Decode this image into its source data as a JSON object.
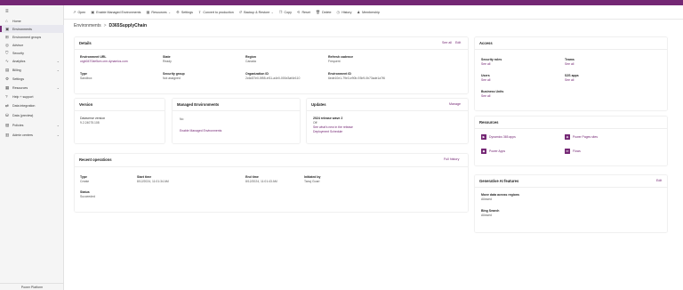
{
  "sidebar": {
    "items": [
      {
        "label": "Home",
        "icon": "home-icon",
        "glyph": "⌂"
      },
      {
        "label": "Environments",
        "icon": "environments-icon",
        "glyph": "▣"
      },
      {
        "label": "Environment groups",
        "icon": "environment-groups-icon",
        "glyph": "⊞"
      },
      {
        "label": "Advisor",
        "icon": "advisor-icon",
        "glyph": "◎"
      },
      {
        "label": "Security",
        "icon": "security-icon",
        "glyph": "⛉"
      },
      {
        "label": "Analytics",
        "icon": "analytics-icon",
        "glyph": "∿"
      },
      {
        "label": "Billing",
        "icon": "billing-icon",
        "glyph": "▤"
      },
      {
        "label": "Settings",
        "icon": "settings-icon",
        "glyph": "⚙"
      },
      {
        "label": "Resources",
        "icon": "resources-icon",
        "glyph": "▦"
      },
      {
        "label": "Help + support",
        "icon": "help-icon",
        "glyph": "?"
      },
      {
        "label": "Data integration",
        "icon": "data-integration-icon",
        "glyph": "⇄"
      },
      {
        "label": "Data (preview)",
        "icon": "data-icon",
        "glyph": "⛁"
      },
      {
        "label": "Policies",
        "icon": "policies-icon",
        "glyph": "▧"
      },
      {
        "label": "Admin centers",
        "icon": "admin-centers-icon",
        "glyph": "▥"
      }
    ],
    "footer": "Power Platform"
  },
  "toolbar": {
    "items": [
      {
        "label": "Open",
        "icon": "open-icon",
        "glyph": "↗"
      },
      {
        "label": "Enable Managed Environments",
        "icon": "managed-environments-icon",
        "glyph": "▣"
      },
      {
        "label": "Resources",
        "icon": "resources-icon",
        "glyph": "▦"
      },
      {
        "label": "Settings",
        "icon": "settings-icon",
        "glyph": "⚙"
      },
      {
        "label": "Convert to production",
        "icon": "convert-icon",
        "glyph": "⇧"
      },
      {
        "label": "Backup & Restore",
        "icon": "backup-icon",
        "glyph": "↺"
      },
      {
        "label": "Copy",
        "icon": "copy-icon",
        "glyph": "❐"
      },
      {
        "label": "Reset",
        "icon": "reset-icon",
        "glyph": "⟲"
      },
      {
        "label": "Delete",
        "icon": "delete-icon",
        "glyph": "🗑"
      },
      {
        "label": "History",
        "icon": "history-icon",
        "glyph": "◷"
      },
      {
        "label": "Membership",
        "icon": "membership-icon",
        "glyph": "♟"
      }
    ]
  },
  "breadcrumb": {
    "parent": "Environments",
    "separator": ">",
    "current": "D365SupplyChain"
  },
  "details": {
    "title": "Details",
    "see_all": "See all",
    "edit": "Edit",
    "fields": {
      "env_url_label": "Environment URL",
      "env_url_value": "orgb0470de5cm.crm.dynamics.com",
      "state_label": "State",
      "state_value": "Ready",
      "region_label": "Region",
      "region_value": "Canada",
      "refresh_label": "Refresh cadence",
      "refresh_value": "Frequent",
      "type_label": "Type",
      "type_value": "Sandbox",
      "security_group_label": "Security group",
      "security_group_value": "Not assigned",
      "org_id_label": "Organization ID",
      "org_id_value": "2c6d37e0-5f55-ef11-a4e0-000d3af4e110",
      "env_id_label": "Environment ID",
      "env_id_value": "6ede10e1-79e3-e90b-93b9-0b73ade1a7f6"
    }
  },
  "version": {
    "title": "Version",
    "label": "Dataverse version",
    "value": "9.2.24075.108"
  },
  "managed": {
    "title": "Managed Environments",
    "value": "No",
    "link": "Enable Managed Environments"
  },
  "updates": {
    "title": "Updates",
    "manage": "Manage",
    "wave": "2024 release wave 2",
    "status": "Off",
    "link1": "See what's new in the release",
    "link2": "Deployment Schedule"
  },
  "recent_ops": {
    "title": "Recent operations",
    "full_history": "Full history",
    "type_label": "Type",
    "type_value": "Create",
    "start_label": "Start time",
    "start_value": "8/12/2024, 11:01:34 AM",
    "end_label": "End time",
    "end_value": "8/12/2024, 11:01:43 AM",
    "initiated_label": "Initiated by",
    "initiated_value": "Tanuj Goari",
    "status_label": "Status",
    "status_value": "Succeeded"
  },
  "access": {
    "title": "Access",
    "security_roles_label": "Security roles",
    "security_roles_link": "See all",
    "teams_label": "Teams",
    "teams_link": "See all",
    "users_label": "Users",
    "users_link": "See all",
    "s2s_label": "S2S apps",
    "s2s_link": "See all",
    "business_units_label": "Business Units",
    "business_units_link": "See all"
  },
  "resources": {
    "title": "Resources",
    "items": [
      {
        "label": "Dynamics 365 apps",
        "icon": "dynamics-apps-icon",
        "glyph": "▶"
      },
      {
        "label": "Power Pages sites",
        "icon": "power-pages-icon",
        "glyph": "◈"
      },
      {
        "label": "Power Apps",
        "icon": "power-apps-icon",
        "glyph": "◆"
      },
      {
        "label": "Flows",
        "icon": "flows-icon",
        "glyph": "≫"
      }
    ]
  },
  "genai": {
    "title": "Generative AI features",
    "edit": "Edit",
    "move_label": "Move data across regions",
    "move_value": "Allowed",
    "bing_label": "Bing Search",
    "bing_value": "Allowed"
  },
  "colors": {
    "accent": "#742774",
    "topbar": "#742774"
  }
}
